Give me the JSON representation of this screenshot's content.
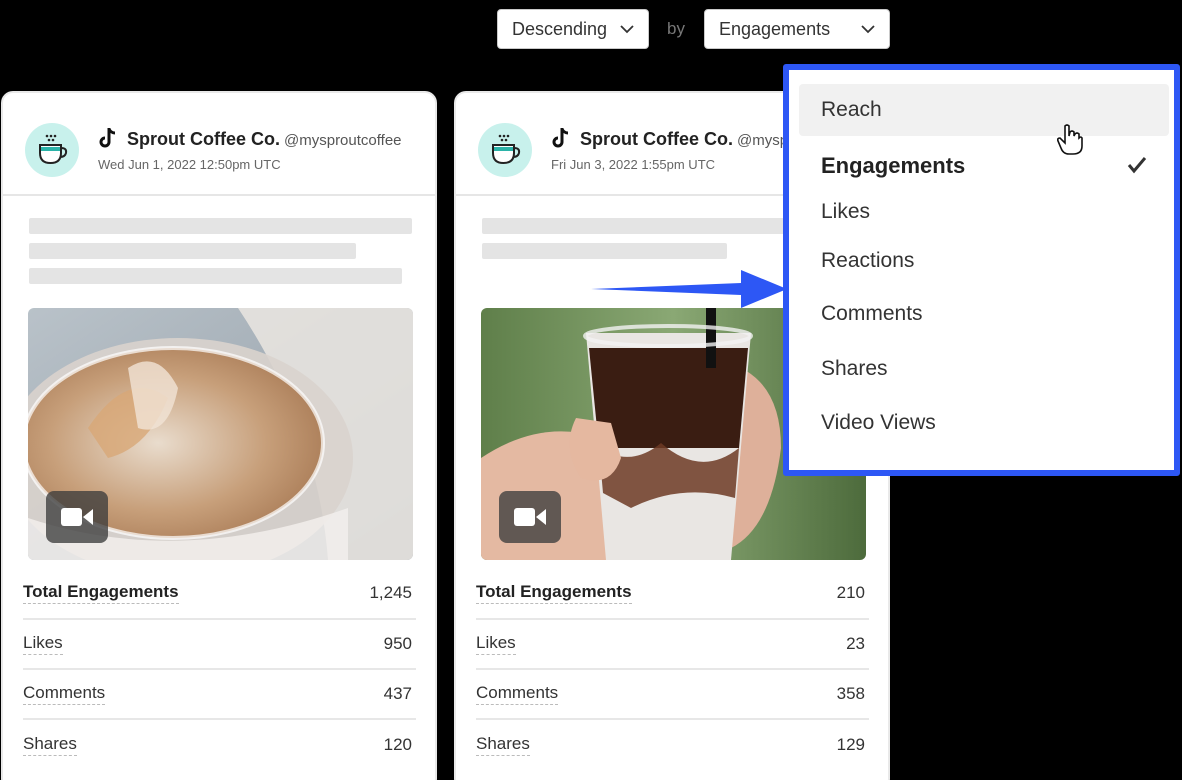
{
  "sort_select": {
    "value": "Descending"
  },
  "by_label": "by",
  "metric_select": {
    "value": "Engagements"
  },
  "cards": [
    {
      "profile_name": "Sprout Coffee Co.",
      "handle": "@mysproutcoffee",
      "date": "Wed Jun 1, 2022 12:50pm UTC",
      "stats": [
        {
          "label": "Total Engagements",
          "value": "1,245"
        },
        {
          "label": "Likes",
          "value": "950"
        },
        {
          "label": "Comments",
          "value": "437"
        },
        {
          "label": "Shares",
          "value": "120"
        }
      ]
    },
    {
      "profile_name": "Sprout Coffee Co.",
      "handle": "@mysproutcoffee",
      "date": "Fri Jun 3, 2022 1:55pm UTC",
      "stats": [
        {
          "label": "Total Engagements",
          "value": "210"
        },
        {
          "label": "Likes",
          "value": "23"
        },
        {
          "label": "Comments",
          "value": "358"
        },
        {
          "label": "Shares",
          "value": "129"
        }
      ]
    }
  ],
  "dropdown": {
    "options": [
      "Reach",
      "Engagements",
      "Likes",
      "Reactions",
      "Comments",
      "Shares",
      "Video Views"
    ],
    "selected": "Engagements",
    "hovered": "Reach"
  },
  "colors": {
    "highlight_blue": "#2d57f5",
    "avatar_bg": "#c8f1ec",
    "background": "#000000"
  }
}
